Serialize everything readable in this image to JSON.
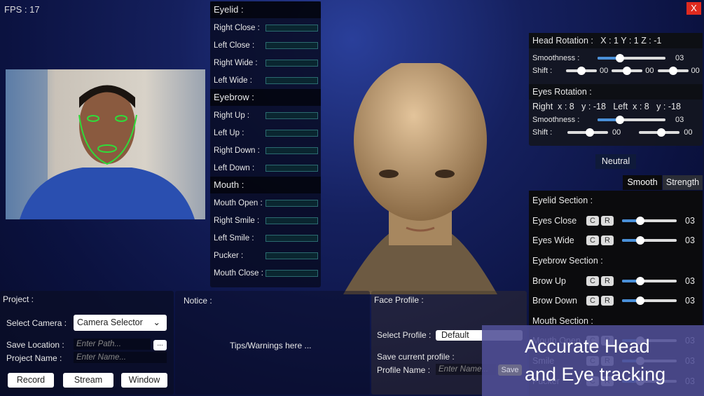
{
  "fps": "FPS : 17",
  "close_label": "X",
  "expression_panel": {
    "sections": [
      {
        "title": "Eyelid :",
        "items": [
          {
            "label": "Right Close :",
            "value": 0
          },
          {
            "label": "Left Close :",
            "value": 0
          },
          {
            "label": "Right Wide :",
            "value": 0
          },
          {
            "label": "Left Wide :",
            "value": 0
          }
        ]
      },
      {
        "title": "Eyebrow :",
        "items": [
          {
            "label": "Right Up :",
            "value": 0
          },
          {
            "label": "Left Up :",
            "value": 0
          },
          {
            "label": "Right Down :",
            "value": 0
          },
          {
            "label": "Left Down :",
            "value": 0
          }
        ]
      },
      {
        "title": "Mouth :",
        "items": [
          {
            "label": "Mouth Open :",
            "value": 0
          },
          {
            "label": "Right Smile :",
            "value": 0
          },
          {
            "label": "Left Smile :",
            "value": 0
          },
          {
            "label": "Pucker :",
            "value": 0
          },
          {
            "label": "Mouth Close :",
            "value": 0
          }
        ]
      }
    ]
  },
  "head_rotation": {
    "title": "Head Rotation :",
    "values": "X : 1  Y : 1  Z : -1",
    "smoothness_label": "Smoothness :",
    "smoothness": "03",
    "smoothness_frac": 0.35,
    "shift_label": "Shift :",
    "shifts": [
      "00",
      "00",
      "00"
    ]
  },
  "eyes_rotation": {
    "title": "Eyes Rotation :",
    "right": "Right  x : 8   y : -18",
    "left": "Left  x : 8   y : -18",
    "smoothness_label": "Smoothness :",
    "smoothness": "03",
    "smoothness_frac": 0.35,
    "shift_label": "Shift :",
    "shifts": [
      "00",
      "00"
    ]
  },
  "neutral_label": "Neutral",
  "tabs": {
    "smooth": "Smooth",
    "strength": "Strength"
  },
  "sections": [
    {
      "type": "header",
      "label": "Eyelid Section :"
    },
    {
      "type": "item",
      "label": "Eyes Close",
      "value": "03"
    },
    {
      "type": "item",
      "label": "Eyes Wide",
      "value": "03"
    },
    {
      "type": "header",
      "label": "Eyebrow Section :"
    },
    {
      "type": "item",
      "label": "Brow Up",
      "value": "03"
    },
    {
      "type": "item",
      "label": "Brow Down",
      "value": "03"
    },
    {
      "type": "header",
      "label": "Mouth Section :"
    },
    {
      "type": "item",
      "label": "Mouth Open",
      "value": "03"
    },
    {
      "type": "item",
      "label": "Smile",
      "value": "03"
    },
    {
      "type": "item",
      "label": "Pucker",
      "value": "03"
    }
  ],
  "c_label": "C",
  "r_label": "R",
  "project": {
    "title": "Project :",
    "camera_label": "Select Camera :",
    "camera_value": "Camera Selector",
    "save_location_label": "Save Location :",
    "path_placeholder": "Enter Path...",
    "browse": "...",
    "name_label": "Project Name :",
    "name_placeholder": "Enter Name...",
    "record": "Record",
    "stream": "Stream",
    "window": "Window"
  },
  "notice": {
    "title": "Notice :",
    "text": "Tips/Warnings here ..."
  },
  "face_profile": {
    "title": "Face Profile :",
    "select_label": "Select Profile :",
    "select_value": "Default",
    "save_title": "Save current profile :",
    "name_label": "Profile Name :",
    "name_placeholder": "Enter Name...",
    "save": "Save"
  },
  "overlay": {
    "line1": "Accurate Head",
    "line2": "and Eye tracking"
  }
}
